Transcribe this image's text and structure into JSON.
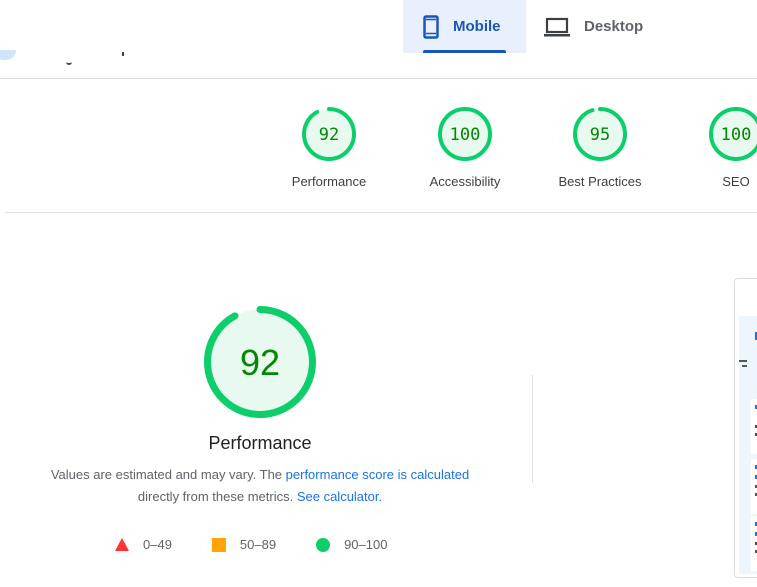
{
  "header": {
    "tabs": [
      {
        "label": "Mobile",
        "icon": "smartphone-icon",
        "active": true
      },
      {
        "label": "Desktop",
        "icon": "laptop-icon",
        "active": false
      }
    ]
  },
  "summary": {
    "gauges": [
      {
        "score": "92",
        "label": "Performance",
        "fraction": 0.92
      },
      {
        "score": "100",
        "label": "Accessibility",
        "fraction": 1.0
      },
      {
        "score": "95",
        "label": "Best Practices",
        "fraction": 0.95
      },
      {
        "score": "100",
        "label": "SEO",
        "fraction": 1.0
      }
    ]
  },
  "performance": {
    "score": "92",
    "fraction": 0.92,
    "title": "Performance",
    "desc_prefix": "Values are estimated and may vary. The ",
    "desc_link1": "performance score is calculated",
    "desc_middle": " directly from these metrics. ",
    "desc_link2": "See calculator."
  },
  "legend": [
    {
      "label": "0–49",
      "icon": "fail-triangle-icon"
    },
    {
      "label": "50–89",
      "icon": "average-square-icon"
    },
    {
      "label": "90–100",
      "icon": "pass-circle-icon"
    }
  ],
  "colors": {
    "pass": "#0cce6b",
    "pass_fill": "#e8f9ef",
    "pass_text": "#008800",
    "average": "#ffa400",
    "fail": "#ff3333",
    "accent": "#1a56b8",
    "link": "#1a73e8"
  }
}
